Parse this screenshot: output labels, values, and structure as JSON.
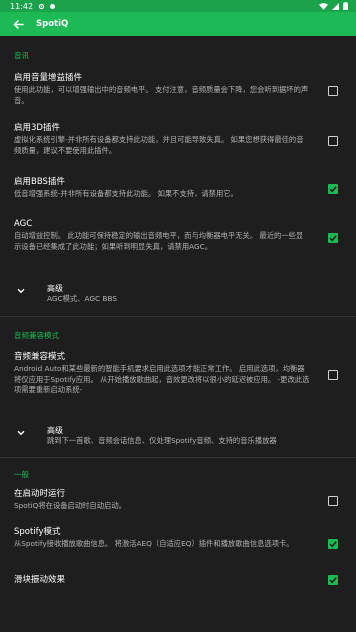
{
  "status_bar": {
    "time": "11:42"
  },
  "app_bar": {
    "title": "SpotiQ"
  },
  "colors": {
    "accent": "#1DB954",
    "status": "#1AA34A",
    "background": "#1E1E1E"
  },
  "sections": {
    "audio": {
      "header": "音讯",
      "items": [
        {
          "title": "启用音量增益插件",
          "subtitle": "使用此功能，可以增强输出中的音频电平。 支付注意，音频质量会下降，您会听到据坏的声音。",
          "checked": false
        },
        {
          "title": "启用3D插件",
          "subtitle": "虚拟化系统引擎-并非所有设备都支持此功能，并且可能导致失真。 如果您想获得最佳的音频质量，建议不要使用此插件。",
          "checked": false
        },
        {
          "title": "启用BBS插件",
          "subtitle": "低音增强系统-并非所有设备都支持此功能。 如果不支持，请禁用它。",
          "checked": true
        },
        {
          "title": "AGC",
          "subtitle": "自动增益控制。 此功能可保持稳定的输出音频电平，而与均衡器电平无关。 最近的一些显示设备已经集成了此功能；如果听到明显失真，请禁用AGC。",
          "checked": true
        }
      ],
      "advanced": {
        "title": "高级",
        "subtitle": "AGC模式、AGC BBS"
      }
    },
    "compat": {
      "header": "音频兼容模式",
      "items": [
        {
          "title": "音频兼容模式",
          "subtitle": "Android Auto和某些最新的智能手机要求启用此选项才能正常工作。 启用此选项，均衡器将仅应用于Spotify应用。 从开始播放歌曲起，音效更改将以很小的延迟被应用。 -更改此选项需要重新启动系统-",
          "checked": false
        }
      ],
      "advanced": {
        "title": "高级",
        "subtitle": "跳到下一首歌、音频会话信息、仅处理Spotify音频、支持的音乐播放器"
      }
    },
    "general": {
      "header": "一般",
      "items": [
        {
          "title": "在启动时运行",
          "subtitle": "SpotiQ将在设备启动时自动启动。",
          "checked": false
        },
        {
          "title": "Spotify模式",
          "subtitle": "从Spotify接收播放歌曲信息。 将激活AEQ（自适应EQ）插件和播放歌曲信息选项卡。",
          "checked": true
        },
        {
          "title": "滑块振动效果",
          "checked": true
        }
      ]
    }
  }
}
